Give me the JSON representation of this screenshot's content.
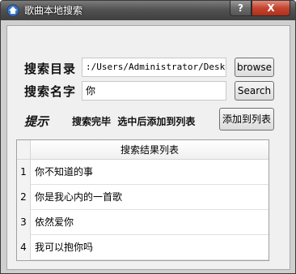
{
  "window": {
    "title": "歌曲本地搜索",
    "help_label": "?",
    "close_label": "X"
  },
  "form": {
    "dir_label": "搜索目录",
    "dir_value": ":/Users/Administrator/Desktop",
    "browse_label": "browse",
    "name_label": "搜索名字",
    "name_value": "你",
    "search_label": "Search",
    "hint_label": "提示",
    "status_text": "搜索完毕  选中后添加到列表",
    "add_label": "添加到列表"
  },
  "results": {
    "header": "搜索结果列表",
    "rows": [
      {
        "num": "1",
        "text": "你不知道的事"
      },
      {
        "num": "2",
        "text": "你是我心内的一首歌"
      },
      {
        "num": "3",
        "text": "依然爱你"
      },
      {
        "num": "4",
        "text": "我可以抱你吗"
      }
    ]
  }
}
